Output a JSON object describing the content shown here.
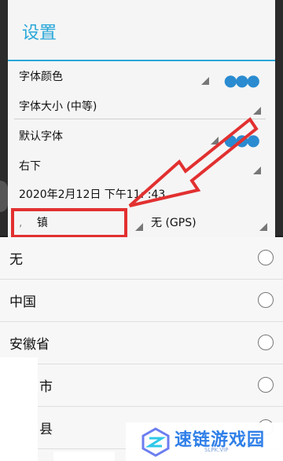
{
  "dialog": {
    "title": "设置",
    "font_color_label": "字体颜色",
    "font_size_label": "字体大小 (中等)",
    "default_font_label": "默认字体",
    "position_label": "右下",
    "datetime_label": "2020年2月12日  下午11:  :43",
    "location_label": "镇",
    "location_prefix": ",",
    "gps_label": "无 (GPS)"
  },
  "radio_options": [
    {
      "label": "无",
      "selected": false
    },
    {
      "label": "中国",
      "selected": false
    },
    {
      "label": "安徽省",
      "selected": false
    },
    {
      "label": "市",
      "selected": false
    },
    {
      "label": "县",
      "selected": false
    }
  ],
  "watermark": {
    "title": "速链游戏园",
    "subtitle": "SLPK.VIP"
  },
  "colors": {
    "accent": "#2aa7d9",
    "annotation": "#e23030"
  }
}
